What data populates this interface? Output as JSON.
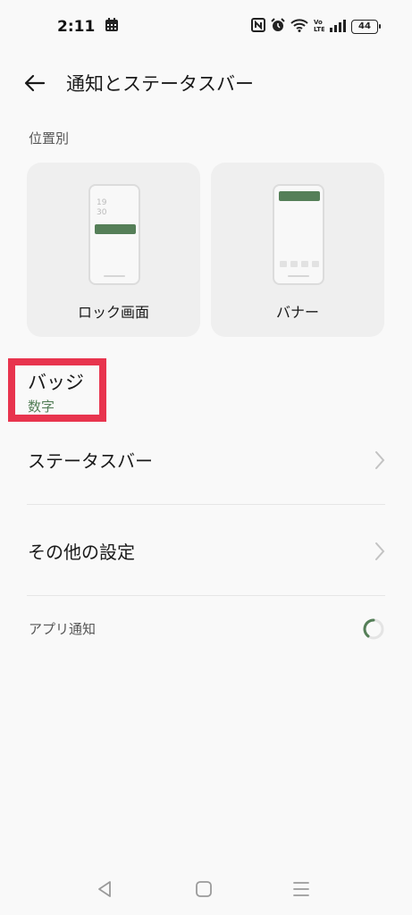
{
  "status_bar": {
    "time": "2:11",
    "battery": "44",
    "icons": [
      "calendar-icon",
      "nfc-icon",
      "alarm-icon",
      "wifi-icon",
      "volte-icon",
      "signal-icon",
      "battery-icon"
    ]
  },
  "app_bar": {
    "title": "通知とステータスバー"
  },
  "section_by_position": {
    "label": "位置別",
    "cards": [
      {
        "label": "ロック画面",
        "clock_hour": "19",
        "clock_min": "30"
      },
      {
        "label": "バナー"
      }
    ]
  },
  "badge": {
    "title": "バッジ",
    "value": "数字"
  },
  "list": {
    "status_bar_label": "ステータスバー",
    "other_settings_label": "その他の設定"
  },
  "app_notifications": {
    "label": "アプリ通知"
  },
  "colors": {
    "accent": "#557f58",
    "highlight": "#e8344e",
    "background": "#f9f9f9",
    "card": "#efefef"
  }
}
